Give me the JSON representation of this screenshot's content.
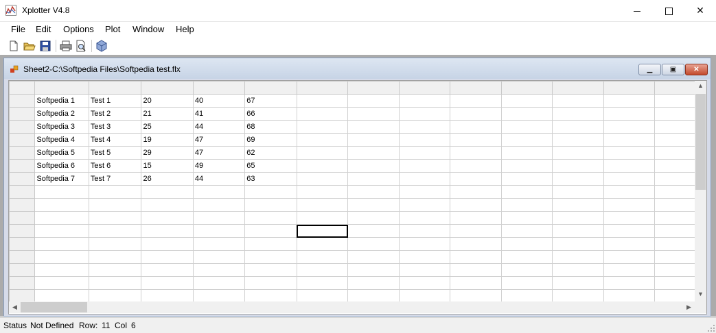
{
  "app": {
    "title": "Xplotter V4.8"
  },
  "menu": [
    "File",
    "Edit",
    "Options",
    "Plot",
    "Window",
    "Help"
  ],
  "toolbar": [
    "new-icon",
    "open-folder-icon",
    "save-icon",
    "print-icon",
    "print-preview-icon",
    "plot-icon"
  ],
  "child_window": {
    "title": "Sheet2-C:\\Softpedia Files\\Softpedia test.flx"
  },
  "grid": {
    "rows": [
      [
        "Softpedia 1",
        "Test 1",
        "20",
        "40",
        "67"
      ],
      [
        "Softpedia 2",
        "Test 2",
        "21",
        "41",
        "66"
      ],
      [
        "Softpedia 3",
        "Test 3",
        "25",
        "44",
        "68"
      ],
      [
        "Softpedia 4",
        "Test 4",
        "19",
        "47",
        "69"
      ],
      [
        "Softpedia 5",
        "Test 5",
        "29",
        "47",
        "62"
      ],
      [
        "Softpedia 6",
        "Test 6",
        "15",
        "49",
        "65"
      ],
      [
        "Softpedia 7",
        "Test 7",
        "26",
        "44",
        "63"
      ]
    ]
  },
  "status": {
    "status_label": "Status",
    "status_value": "Not Defined",
    "row_label": "Row:",
    "row_value": "11",
    "col_label": "Col",
    "col_value": "6"
  },
  "colors": {
    "mdi_background": "#ababab",
    "child_title": "#c7d4e6",
    "close_button": "#c34a2c"
  }
}
